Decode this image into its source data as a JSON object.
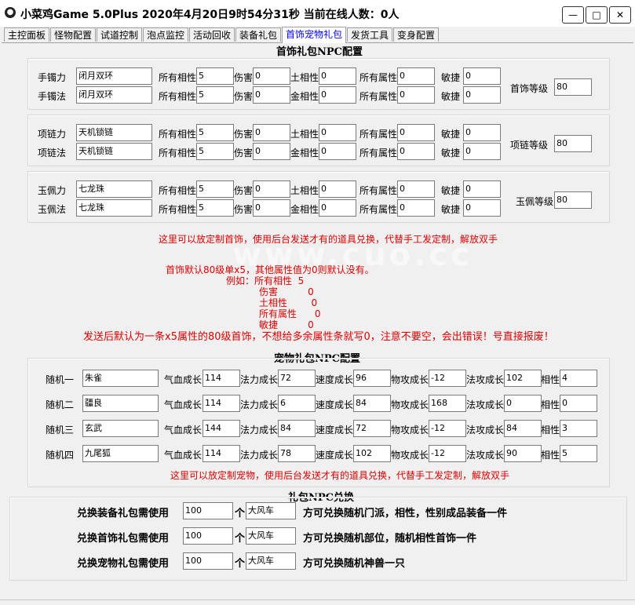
{
  "window": {
    "title": "小菜鸡Game 5.0Plus  2020年4月20日9时54分31秒  当前在线人数：0人",
    "minimize": "—",
    "maximize": "□",
    "close": "✕",
    "icon": "app-icon"
  },
  "tabs": [
    "主控面板",
    "怪物配置",
    "试道控制",
    "泡点监控",
    "活动回收",
    "装备礼包",
    "首饰宠物礼包",
    "发货工具",
    "变身配置"
  ],
  "jewelry": {
    "title": "首饰礼包NPC配置",
    "labels": {
      "all_phase": "所有相性",
      "damage": "伤害",
      "earth": "土相性",
      "metal": "金相性",
      "all_attr": "所有属性",
      "agility": "敏捷"
    },
    "groups": [
      {
        "rows": [
          {
            "label": "手镯力",
            "name": "闭月双环",
            "all_phase": "5",
            "damage": "0",
            "phase_label": "土相性",
            "phase": "0",
            "all_attr": "0",
            "agility": "0"
          },
          {
            "label": "手镯法",
            "name": "闭月双环",
            "all_phase": "5",
            "damage": "0",
            "phase_label": "金相性",
            "phase": "0",
            "all_attr": "0",
            "agility": "0"
          }
        ],
        "level_label": "首饰等级",
        "level": "80"
      },
      {
        "rows": [
          {
            "label": "项链力",
            "name": "天机锁链",
            "all_phase": "5",
            "damage": "0",
            "phase_label": "土相性",
            "phase": "0",
            "all_attr": "0",
            "agility": "0"
          },
          {
            "label": "项链法",
            "name": "天机锁链",
            "all_phase": "5",
            "damage": "0",
            "phase_label": "金相性",
            "phase": "0",
            "all_attr": "0",
            "agility": "0"
          }
        ],
        "level_label": "项链等级",
        "level": "80"
      },
      {
        "rows": [
          {
            "label": "玉佩力",
            "name": "七龙珠",
            "all_phase": "5",
            "damage": "0",
            "phase_label": "土相性",
            "phase": "0",
            "all_attr": "0",
            "agility": "0"
          },
          {
            "label": "玉佩法",
            "name": "七龙珠",
            "all_phase": "5",
            "damage": "0",
            "phase_label": "金相性",
            "phase": "0",
            "all_attr": "0",
            "agility": "0"
          }
        ],
        "level_label": "玉佩等级",
        "level": "80"
      }
    ],
    "note1": "这里可以放定制首饰，使用后台发送才有的道具兑换，代替手工发定制，解放双手",
    "note2": "首饰默认80级单x5，其他属性值为0则默认没有。",
    "example": [
      "例如：所有相性  5",
      "伤害          0",
      "土相性        0",
      "所有属性      0",
      "敏捷          0"
    ],
    "warning": "发送后默认为一条x5属性的80级首饰，不想给多余属性条就写0，注意不要空，会出错误！号直接报废！"
  },
  "pet": {
    "title": "宠物礼包NPC配置",
    "labels": {
      "hp": "气血成长",
      "mp": "法力成长",
      "speed": "速度成长",
      "phy": "物攻成长",
      "mag": "法攻成长",
      "phase": "相性"
    },
    "rows": [
      {
        "label": "随机一",
        "name": "朱雀",
        "hp": "114",
        "mp": "72",
        "speed": "96",
        "phy": "-12",
        "mag": "102",
        "phase": "4"
      },
      {
        "label": "随机二",
        "name": "疆良",
        "hp": "114",
        "mp": "6",
        "speed": "84",
        "phy": "168",
        "mag": "0",
        "phase": "0"
      },
      {
        "label": "随机三",
        "name": "玄武",
        "hp": "144",
        "mp": "84",
        "speed": "72",
        "phy": "-12",
        "mag": "84",
        "phase": "3"
      },
      {
        "label": "随机四",
        "name": "九尾狐",
        "hp": "114",
        "mp": "78",
        "speed": "102",
        "phy": "-12",
        "mag": "90",
        "phase": "5"
      }
    ],
    "note": "这里可以放定制宠物，使用后台发送才有的道具兑换，代替手工发定制，解放双手"
  },
  "exchange": {
    "title": "礼包NPC兑换",
    "unit": "个",
    "rows": [
      {
        "label": "兑换装备礼包需使用",
        "count": "100",
        "item": "大风车",
        "desc": "方可兑换随机门派，相性，性别成品装备一件"
      },
      {
        "label": "兑换首饰礼包需使用",
        "count": "100",
        "item": "大风车",
        "desc": "方可兑换随机部位，随机相性首饰一件"
      },
      {
        "label": "兑换宠物礼包需使用",
        "count": "100",
        "item": "大风车",
        "desc": "方可兑换随机神兽一只"
      }
    ]
  },
  "watermark": "www.cuo.cc",
  "colors": {
    "accent_tab": "#0000ff",
    "warning": "#e00000"
  }
}
